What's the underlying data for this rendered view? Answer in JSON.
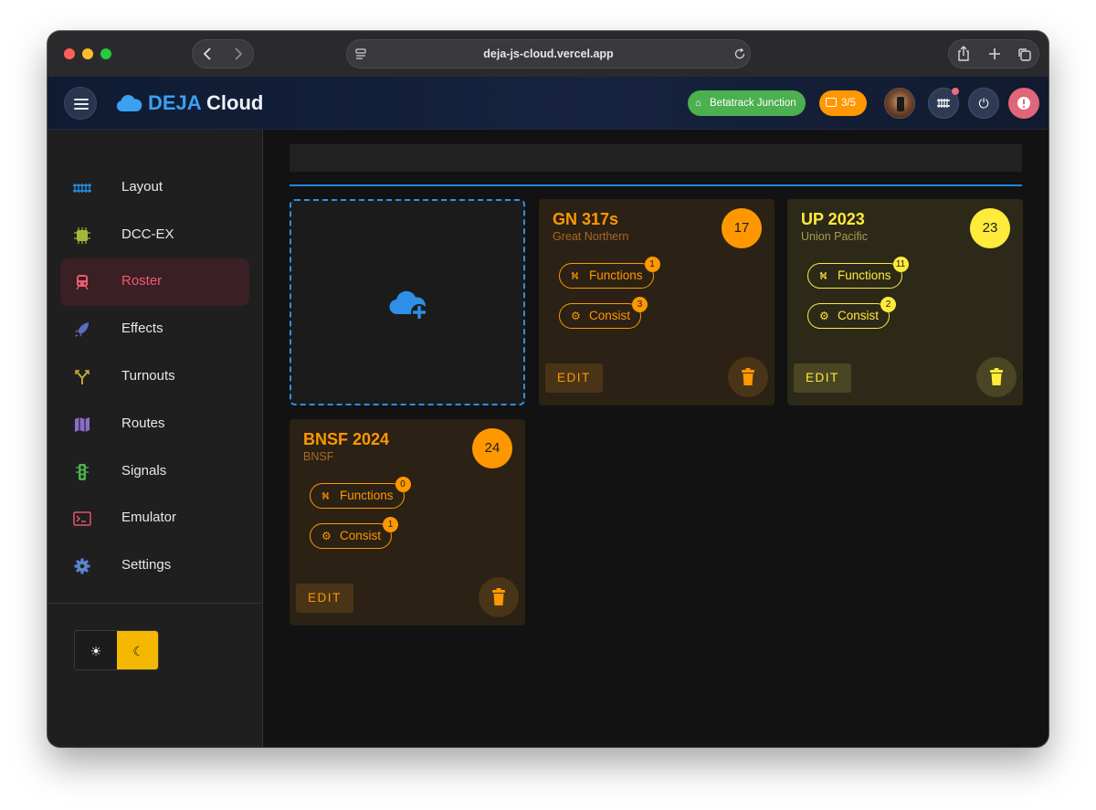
{
  "browser": {
    "url": "deja-js-cloud.vercel.app"
  },
  "header": {
    "brand_primary": "DEJA",
    "brand_secondary": "Cloud",
    "layout_chip": "Betatrack Junction",
    "throttle_count": "3/5",
    "icons": [
      "menu-icon",
      "cloud-icon",
      "home-icon",
      "throttle-icon",
      "avatar",
      "track-icon",
      "power-icon",
      "alert-icon"
    ]
  },
  "sidebar": {
    "items": [
      {
        "label": "Layout",
        "icon": "track-icon",
        "color": "#2196f3"
      },
      {
        "label": "DCC-EX",
        "icon": "chip-icon",
        "color": "#a3b83a"
      },
      {
        "label": "Roster",
        "icon": "train-icon",
        "color": "#ef5b72",
        "active": true
      },
      {
        "label": "Effects",
        "icon": "rocket-icon",
        "color": "#5c6bc0"
      },
      {
        "label": "Turnouts",
        "icon": "fork-icon",
        "color": "#c9b03a"
      },
      {
        "label": "Routes",
        "icon": "map-icon",
        "color": "#8e6bc8"
      },
      {
        "label": "Signals",
        "icon": "traffic-light-icon",
        "color": "#4caf50"
      },
      {
        "label": "Emulator",
        "icon": "terminal-icon",
        "color": "#e05570"
      },
      {
        "label": "Settings",
        "icon": "gear-icon",
        "color": "#5b86d6"
      }
    ],
    "theme": {
      "light_icon": "☀",
      "dark_icon": "☾",
      "selected": "dark"
    }
  },
  "roster": {
    "add_icon": "cloud-plus-icon",
    "cards": [
      {
        "name": "GN 317s",
        "road": "Great Northern",
        "address": "17",
        "theme": "orange",
        "functions_label": "Functions",
        "functions_count": "1",
        "consist_label": "Consist",
        "consist_count": "3",
        "edit_label": "EDIT"
      },
      {
        "name": "UP 2023",
        "road": "Union Pacific",
        "address": "23",
        "theme": "yellow",
        "functions_label": "Functions",
        "functions_count": "11",
        "consist_label": "Consist",
        "consist_count": "2",
        "edit_label": "EDIT"
      },
      {
        "name": "BNSF 2024",
        "road": "BNSF",
        "address": "24",
        "theme": "orange",
        "functions_label": "Functions",
        "functions_count": "0",
        "consist_label": "Consist",
        "consist_count": "1",
        "edit_label": "EDIT"
      }
    ]
  },
  "colors": {
    "accent_blue": "#1e88e5",
    "orange": "#ff9800",
    "yellow": "#ffeb3b",
    "active_red": "#ef5b72"
  }
}
